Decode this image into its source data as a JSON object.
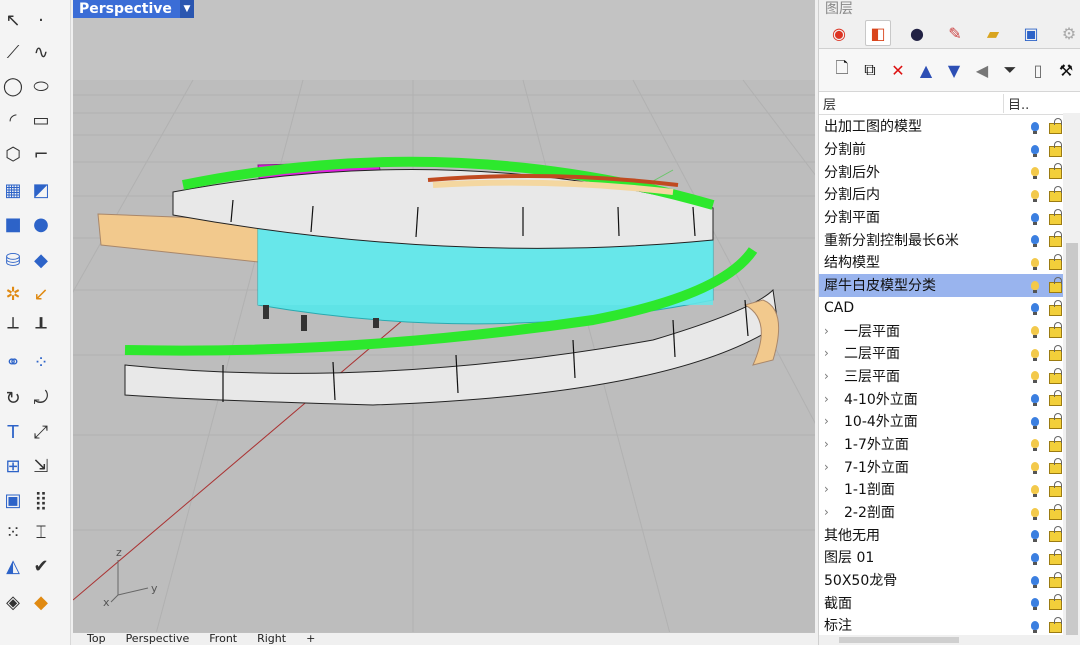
{
  "viewport": {
    "title": "Perspective",
    "axis_labels": {
      "z": "z",
      "y": "y",
      "x": "x"
    },
    "bottom_tabs": [
      "Top",
      "Perspective",
      "Front",
      "Right",
      "+"
    ]
  },
  "panel": {
    "title": "图层",
    "tabs": [
      "color-wheel-icon",
      "layers-icon",
      "render-icon",
      "brush-icon",
      "folder-icon",
      "display-icon",
      "settings-icon"
    ],
    "tools": [
      "new-layer-icon",
      "new-sublayer-icon",
      "delete-icon",
      "move-up-icon",
      "move-down-icon",
      "filter-left-icon",
      "filter-icon",
      "page-icon",
      "tools-icon"
    ],
    "header": {
      "name": "层",
      "current": "目.."
    },
    "layers": [
      {
        "name": "出加工图的模型",
        "child": false,
        "on": true
      },
      {
        "name": "分割前",
        "child": false,
        "on": true
      },
      {
        "name": "分割后外",
        "child": false,
        "on": false
      },
      {
        "name": "分割后内",
        "child": false,
        "on": false
      },
      {
        "name": "分割平面",
        "child": false,
        "on": true
      },
      {
        "name": "重新分割控制最长6米",
        "child": false,
        "on": true
      },
      {
        "name": "结构模型",
        "child": false,
        "on": false
      },
      {
        "name": "犀牛白皮模型分类",
        "child": false,
        "on": false,
        "selected": true
      },
      {
        "name": "CAD",
        "child": false,
        "on": true
      },
      {
        "name": "一层平面",
        "child": true,
        "on": false
      },
      {
        "name": "二层平面",
        "child": true,
        "on": false
      },
      {
        "name": "三层平面",
        "child": true,
        "on": false
      },
      {
        "name": "4-10外立面",
        "child": true,
        "on": true
      },
      {
        "name": "10-4外立面",
        "child": true,
        "on": true
      },
      {
        "name": "1-7外立面",
        "child": true,
        "on": false
      },
      {
        "name": "7-1外立面",
        "child": true,
        "on": false
      },
      {
        "name": "1-1剖面",
        "child": true,
        "on": false
      },
      {
        "name": "2-2剖面",
        "child": true,
        "on": false
      },
      {
        "name": "其他无用",
        "child": false,
        "on": true
      },
      {
        "name": "图层 01",
        "child": false,
        "on": true
      },
      {
        "name": "50X50龙骨",
        "child": false,
        "on": true
      },
      {
        "name": "截面",
        "child": false,
        "on": true
      },
      {
        "name": "标注",
        "child": false,
        "on": true
      }
    ]
  }
}
